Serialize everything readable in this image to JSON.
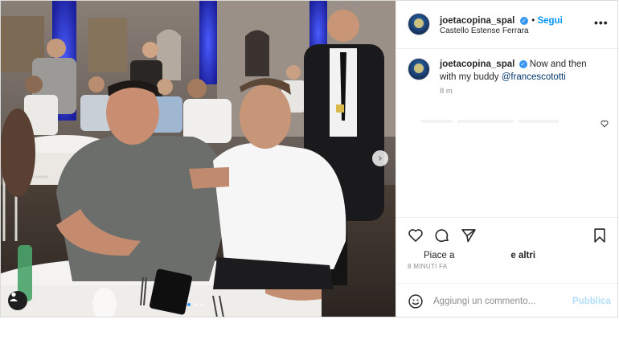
{
  "post": {
    "username": "joetacopina_spal",
    "follow_label": "Segui",
    "location": "Castello Estense Ferrara",
    "more_label": "•••",
    "caption_username": "joetacopina_spal",
    "caption_text": "Now and then with my buddy ",
    "caption_mention": "@francescototti",
    "caption_time": "8 m",
    "likes_prefix": "Piace a",
    "likes_suffix": "e altri",
    "time_ago": "8 MINUTI FA",
    "comment_placeholder": "Aggiungi un commento...",
    "publish_label": "Pubblica",
    "next_arrow": "›",
    "carousel_active_index": 0,
    "carousel_count": 3
  },
  "icons": [
    "next-arrow-icon",
    "user-tag-icon",
    "verified-badge-icon",
    "more-options-icon",
    "heart-outline-icon",
    "comment-icon",
    "share-icon",
    "bookmark-icon",
    "emoji-icon"
  ],
  "colors": {
    "link_blue": "#0095f6",
    "mention": "#00376b",
    "muted": "#8e8e8e",
    "publish_disabled": "#b2dffc",
    "border": "#efefef"
  }
}
